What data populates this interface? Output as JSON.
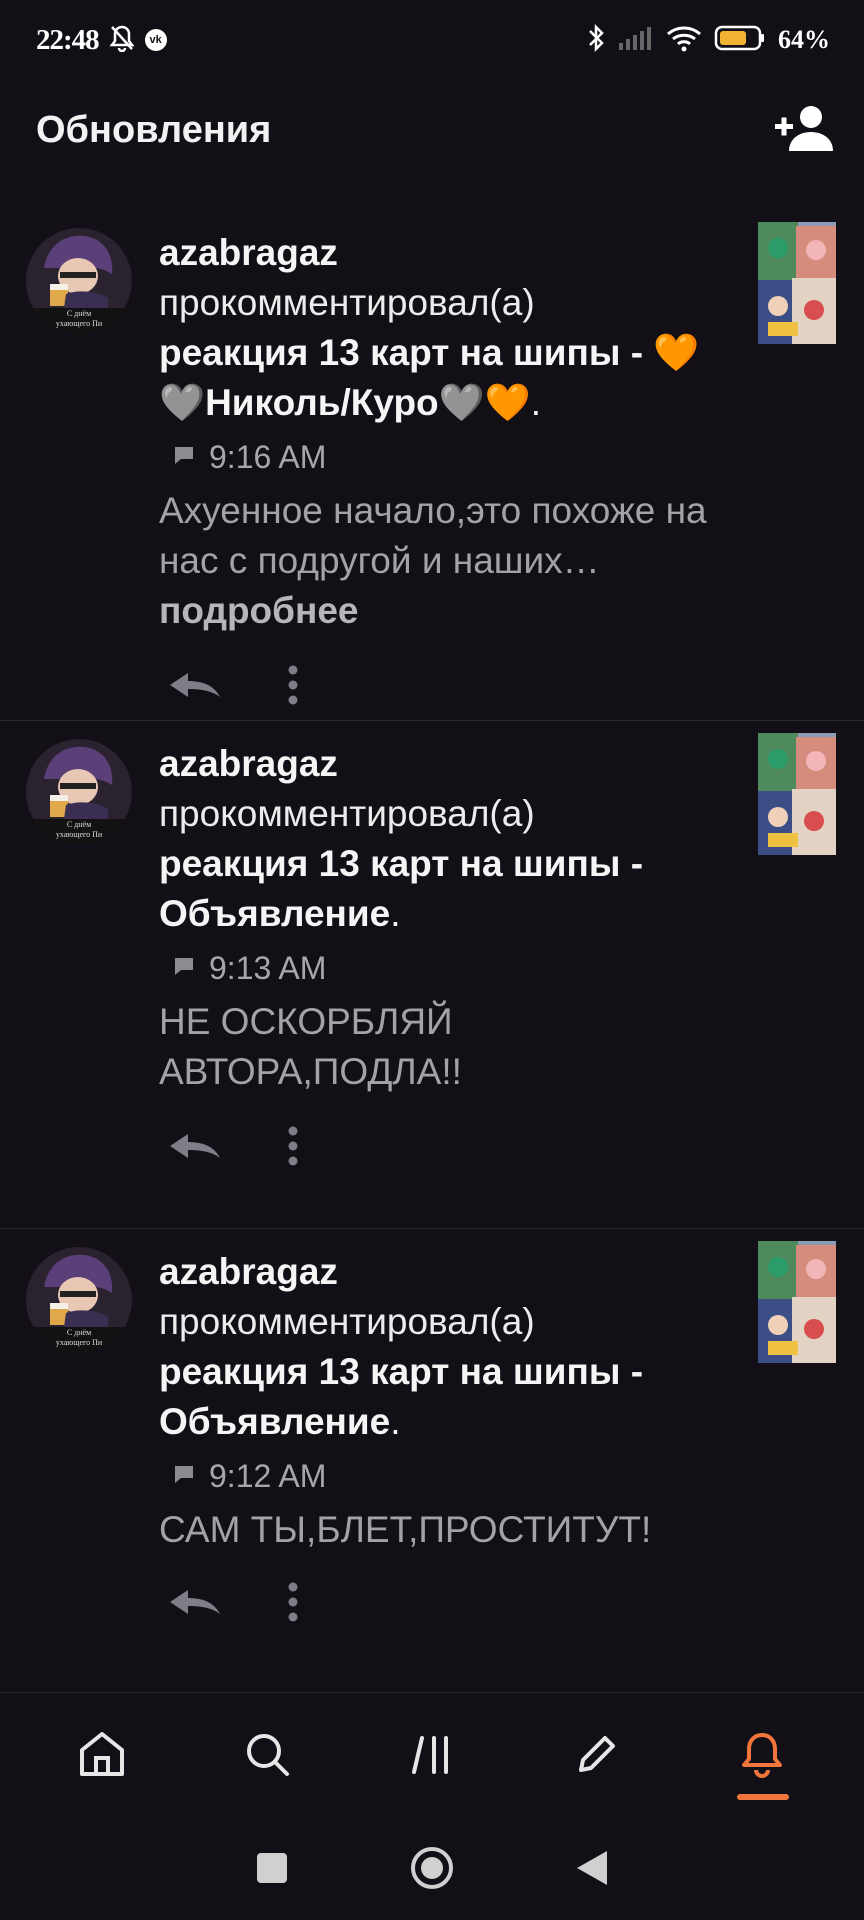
{
  "status_bar": {
    "time": "22:48",
    "battery_percent": "64%"
  },
  "header": {
    "title": "Обновления"
  },
  "feed": [
    {
      "username": "azabragaz",
      "action": "прокомментировал(а)",
      "post_title": "реакция 13 карт на шипы - 🧡🩶Николь/Куро🩶🧡",
      "time": "9:16 AM",
      "comment": "Ахуенное начало,это похоже на нас с подругой и наших…",
      "more": "подробнее"
    },
    {
      "username": "azabragaz",
      "action": "прокомментировал(а)",
      "post_title": "реакция 13 карт на шипы - Объявление",
      "time": "9:13 AM",
      "comment": "НЕ ОСКОРБЛЯЙ АВТОРА,ПОДЛА!!"
    },
    {
      "username": "azabragaz",
      "action": "прокомментировал(а)",
      "post_title": "реакция 13 карт на шипы - Объявление",
      "time": "9:12 AM",
      "comment": "САМ ТЫ,БЛЕТ,ПРОСТИТУТ!"
    }
  ],
  "avatar_caption": [
    "С днём",
    "ухающего Пи"
  ],
  "colors": {
    "accent": "#f2763b",
    "background": "#121016",
    "muted_text": "#a4a2a9"
  }
}
